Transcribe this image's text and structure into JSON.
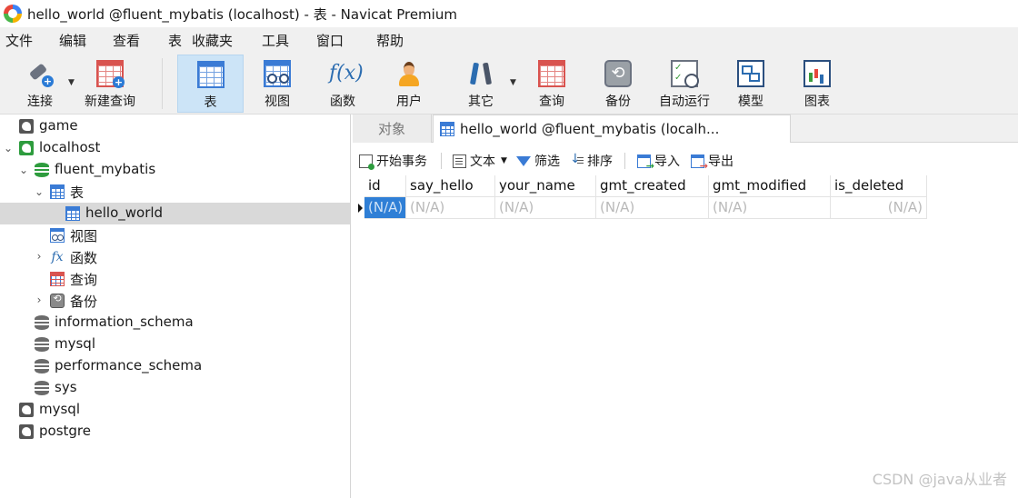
{
  "window": {
    "title": "hello_world @fluent_mybatis (localhost) - 表 - Navicat Premium"
  },
  "menubar": {
    "items": [
      {
        "label": "文件"
      },
      {
        "label": "编辑"
      },
      {
        "label": "查看"
      },
      {
        "label": "表"
      },
      {
        "label": "收藏夹"
      },
      {
        "label": "工具"
      },
      {
        "label": "窗口"
      },
      {
        "label": "帮助"
      }
    ]
  },
  "toolbar": {
    "active": "表",
    "buttons": [
      {
        "label": "连接",
        "icon": "plug-icon",
        "dropdown": true
      },
      {
        "label": "新建查询",
        "icon": "new-query-icon"
      },
      {
        "label": "表",
        "icon": "table-icon"
      },
      {
        "label": "视图",
        "icon": "view-icon"
      },
      {
        "label": "函数",
        "icon": "function-icon"
      },
      {
        "label": "用户",
        "icon": "user-icon"
      },
      {
        "label": "其它",
        "icon": "tools-icon",
        "dropdown": true
      },
      {
        "label": "查询",
        "icon": "query-icon"
      },
      {
        "label": "备份",
        "icon": "backup-icon"
      },
      {
        "label": "自动运行",
        "icon": "schedule-icon"
      },
      {
        "label": "模型",
        "icon": "model-icon"
      },
      {
        "label": "图表",
        "icon": "chart-icon"
      }
    ]
  },
  "tree": {
    "selected": "hello_world",
    "nodes": [
      {
        "label": "game",
        "icon": "connection-icon",
        "level": 0
      },
      {
        "label": "localhost",
        "icon": "connection-icon",
        "level": 0,
        "expanded": true
      },
      {
        "label": "fluent_mybatis",
        "icon": "database-icon",
        "level": 1,
        "expanded": true
      },
      {
        "label": "表",
        "icon": "table-icon",
        "level": 2,
        "expanded": true
      },
      {
        "label": "hello_world",
        "icon": "table-icon",
        "level": 3
      },
      {
        "label": "视图",
        "icon": "view-icon",
        "level": 2
      },
      {
        "label": "函数",
        "icon": "function-icon",
        "level": 2,
        "collapsed": true
      },
      {
        "label": "查询",
        "icon": "query-icon",
        "level": 2
      },
      {
        "label": "备份",
        "icon": "backup-icon",
        "level": 2,
        "collapsed": true
      },
      {
        "label": "information_schema",
        "icon": "database-icon",
        "level": 1
      },
      {
        "label": "mysql",
        "icon": "database-icon",
        "level": 1
      },
      {
        "label": "performance_schema",
        "icon": "database-icon",
        "level": 1
      },
      {
        "label": "sys",
        "icon": "database-icon",
        "level": 1
      },
      {
        "label": "mysql",
        "icon": "connection-icon",
        "level": 0
      },
      {
        "label": "postgre",
        "icon": "connection-icon",
        "level": 0
      }
    ]
  },
  "tabs": [
    {
      "label": "对象",
      "active": false
    },
    {
      "label": "hello_world @fluent_mybatis (localh...",
      "active": true
    }
  ],
  "subtoolbar": {
    "begin_tx": "开始事务",
    "text": "文本",
    "filter": "筛选",
    "sort": "排序",
    "import": "导入",
    "export": "导出"
  },
  "grid": {
    "columns": [
      "id",
      "say_hello",
      "your_name",
      "gmt_created",
      "gmt_modified",
      "is_deleted"
    ],
    "rows": [
      [
        "(N/A)",
        "(N/A)",
        "(N/A)",
        "(N/A)",
        "(N/A)",
        "(N/A)"
      ]
    ]
  },
  "watermark": "CSDN @java从业者",
  "colors": {
    "selection": "#2f7fd6",
    "toolbar_active": "#cce4f7",
    "tree_selected": "#d9d9d9"
  }
}
